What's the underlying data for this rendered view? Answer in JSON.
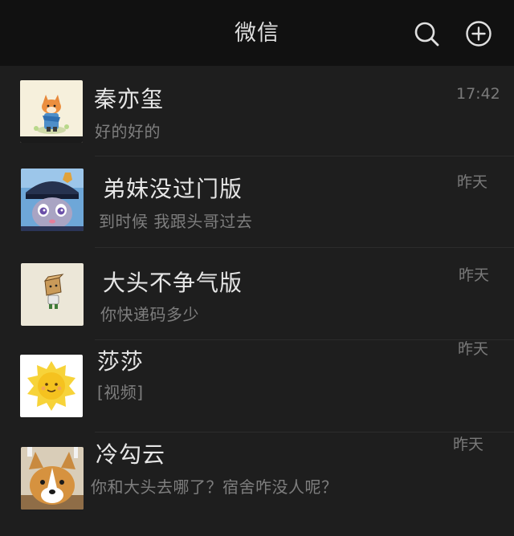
{
  "header": {
    "title": "微信",
    "search_icon": "search-icon",
    "add_icon": "plus-circle-icon"
  },
  "colors": {
    "background": "#191919",
    "header_bg": "#111111",
    "name_text": "#e6e6e6",
    "secondary_text": "#7e7e7e"
  },
  "chats": [
    {
      "name": "秦亦玺",
      "message": "好的好的",
      "time": "17:42",
      "avatar": "fox-cartoon-avatar"
    },
    {
      "name": "弟妹没过门版",
      "message": "到时候 我跟头哥过去",
      "time": "昨天",
      "avatar": "bunny-police-avatar"
    },
    {
      "name": "大头不争气版",
      "message": "你快递码多少",
      "time": "昨天",
      "avatar": "box-head-avatar"
    },
    {
      "name": "莎莎",
      "message": "[视频]",
      "time": "昨天",
      "avatar": "sun-avatar"
    },
    {
      "name": "冷勾云",
      "message": "你和大头去哪了？宿舍咋没人呢？",
      "time": "昨天",
      "avatar": "corgi-avatar"
    }
  ]
}
